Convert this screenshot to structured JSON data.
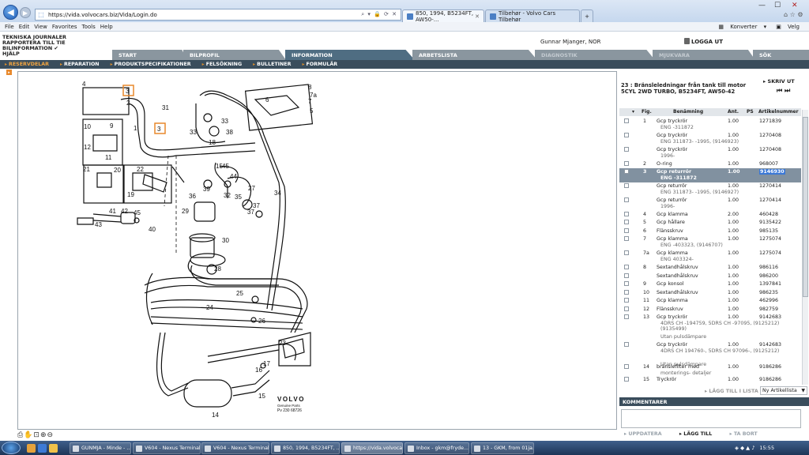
{
  "browser": {
    "url": "https://vida.volvocars.biz/Vida/Login.do",
    "tabs": [
      {
        "label": "850, 1994, B5234FT, AW50-..."
      },
      {
        "label": "Tilbehør - Volvo Cars Tilbehør"
      }
    ],
    "menu": [
      "File",
      "Edit",
      "View",
      "Favorites",
      "Tools",
      "Help"
    ],
    "toolbar_right": [
      "Konverter",
      "Velg"
    ]
  },
  "vida": {
    "left_links": [
      "TEKNISKA JOURNALER",
      "RAPPORTERA TILL TIE",
      "BILINFORMATION ✔",
      "HJÄLP"
    ],
    "user": "Gunnar Mjanger, NOR",
    "logout": "LOGGA UT",
    "main_tabs": [
      {
        "label": "START"
      },
      {
        "label": "BILPROFIL"
      },
      {
        "label": "INFORMATION"
      },
      {
        "label": "ARBETSLISTA"
      },
      {
        "label": "DIAGNOSTIK"
      },
      {
        "label": "MJUKVARA"
      },
      {
        "label": "SÖK"
      }
    ],
    "sub_tabs": [
      {
        "label": "RESERVDELAR"
      },
      {
        "label": "REPARATION"
      },
      {
        "label": "PRODUKTSPECIFIKATIONER"
      },
      {
        "label": "FELSÖKNING"
      },
      {
        "label": "BULLETINER"
      },
      {
        "label": "FORMULÄR"
      }
    ]
  },
  "diagram": {
    "callouts": [
      "4",
      "3",
      "2",
      "31",
      "33",
      "8",
      "7a",
      "6",
      "7",
      "5",
      "10",
      "9",
      "1",
      "12",
      "11",
      "3",
      "33",
      "38",
      "18",
      "21",
      "20",
      "22",
      "19",
      "44",
      "15",
      "45",
      "39",
      "36",
      "29",
      "32",
      "37",
      "27",
      "35",
      "37",
      "34",
      "41",
      "42",
      "45",
      "43",
      "40",
      "30",
      "28",
      "25",
      "24",
      "26",
      "23",
      "17",
      "16",
      "15",
      "14"
    ],
    "logo": "VOLVO",
    "logo_sub": "Genuine Parts",
    "ref": "Pv 230 68726"
  },
  "parts": {
    "title": "23 : Bränsleledningar från tank till motor 5CYL 2WD TURBO, B5234FT, AW50-42",
    "print": "SKRIV UT",
    "columns": [
      "Fig.",
      "Benämning",
      "Ant.",
      "PS",
      "Artikelnummer"
    ],
    "rows": [
      {
        "fig": "1",
        "name": "Gcp tryckrör",
        "sub": "ENG -311872",
        "qty": "1.00",
        "art": "1271839"
      },
      {
        "fig": "",
        "name": "Gcp tryckrör",
        "sub": "ENG 311873- -1995, (9146923)",
        "qty": "1.00",
        "art": "1270408"
      },
      {
        "fig": "",
        "name": "Gcp tryckrör",
        "sub": "1996-",
        "qty": "1.00",
        "art": "1270408"
      },
      {
        "fig": "2",
        "name": "O-ring",
        "sub": "",
        "qty": "1.00",
        "art": "968007"
      },
      {
        "fig": "3",
        "name": "Gcp returrör",
        "sub": "ENG -311872",
        "qty": "1.00",
        "art": "9146930"
      },
      {
        "fig": "",
        "name": "Gcp returrör",
        "sub": "ENG 311873- -1995, (9146927)",
        "qty": "1.00",
        "art": "1270414"
      },
      {
        "fig": "",
        "name": "Gcp returrör",
        "sub": "1996-",
        "qty": "1.00",
        "art": "1270414"
      },
      {
        "fig": "4",
        "name": "Gcp klamma",
        "sub": "",
        "qty": "2.00",
        "art": "460428"
      },
      {
        "fig": "5",
        "name": "Gcp hållare",
        "sub": "",
        "qty": "1.00",
        "art": "9135422"
      },
      {
        "fig": "6",
        "name": "Flänsskruv",
        "sub": "",
        "qty": "1.00",
        "art": "985135"
      },
      {
        "fig": "7",
        "name": "Gcp klamma",
        "sub": "ENG -403323, (9146707)",
        "qty": "1.00",
        "art": "1275074"
      },
      {
        "fig": "7a",
        "name": "Gcp klamma",
        "sub": "ENG 403324-",
        "qty": "1.00",
        "art": "1275074"
      },
      {
        "fig": "8",
        "name": "Sextandhålskruv",
        "sub": "",
        "qty": "1.00",
        "art": "986116"
      },
      {
        "fig": "",
        "name": "Sextandhålskruv",
        "sub": "",
        "qty": "1.00",
        "art": "986200"
      },
      {
        "fig": "9",
        "name": "Gcp konsol",
        "sub": "",
        "qty": "1.00",
        "art": "1397841"
      },
      {
        "fig": "10",
        "name": "Sextandhålskruv",
        "sub": "",
        "qty": "1.00",
        "art": "986235"
      },
      {
        "fig": "11",
        "name": "Gcp klamma",
        "sub": "",
        "qty": "1.00",
        "art": "462996"
      },
      {
        "fig": "12",
        "name": "Flänsskruv",
        "sub": "",
        "qty": "1.00",
        "art": "982759"
      },
      {
        "fig": "13",
        "name": "Gcp tryckrör",
        "sub": "4DRS CH -194759, 5DRS CH -97095, (9125212) (9135499)",
        "sub2": "Utan pulsdämpare",
        "qty": "1.00",
        "art": "9142683"
      },
      {
        "fig": "",
        "name": "Gcp tryckrör",
        "sub": "4DRS CH 194760-, 5DRS CH 97096-, (9125212)",
        "sub2": "Utan pulsdämpare",
        "qty": "1.00",
        "art": "9142683"
      },
      {
        "fig": "14",
        "name": "bränslefilter med",
        "sub": "monterings- detaljer",
        "qty": "1.00",
        "art": "9186286"
      },
      {
        "fig": "15",
        "name": "Tryckrör",
        "sub": "",
        "qty": "1.00",
        "art": "9186286"
      }
    ],
    "add_to_list": "LÄGG TILL I LISTA",
    "sort": "Ny Artikellista",
    "comments_title": "KOMMENTARER",
    "comment_buttons": [
      "UPPDATERA",
      "LÄGG TILL",
      "TA BORT"
    ]
  },
  "taskbar": {
    "items": [
      {
        "label": "GUNMJA - Minde - ..."
      },
      {
        "label": "V604 - Nexus Terminal"
      },
      {
        "label": "V604 - Nexus Terminal"
      },
      {
        "label": "850, 1994, B5234FT, ..."
      },
      {
        "label": "https://vida.volvoca..."
      },
      {
        "label": "Inbox - gkm@fryde..."
      },
      {
        "label": "13 - GKM, from 01ja..."
      }
    ],
    "clock": "15:55"
  }
}
